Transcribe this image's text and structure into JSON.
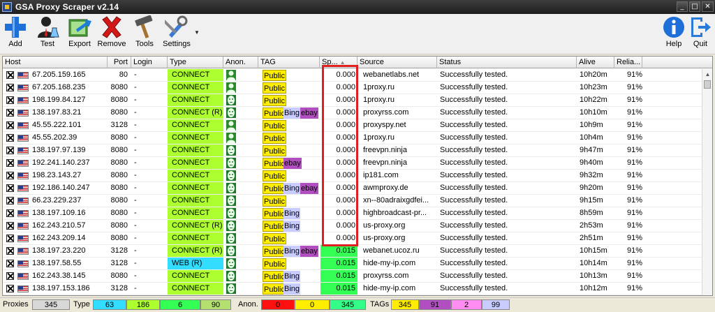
{
  "window": {
    "title": "GSA Proxy Scraper v2.14"
  },
  "toolbar": {
    "add": "Add",
    "test": "Test",
    "export": "Export",
    "remove": "Remove",
    "tools": "Tools",
    "settings": "Settings",
    "help": "Help",
    "quit": "Quit"
  },
  "columns": {
    "host": "Host",
    "port": "Port",
    "login": "Login",
    "type": "Type",
    "anon": "Anon.",
    "tag": "TAG",
    "speed": "Sp...",
    "source": "Source",
    "status": "Status",
    "alive": "Alive",
    "reliability": "Relia..."
  },
  "rows": [
    {
      "host": "67.205.159.165",
      "port": "80",
      "login": "-",
      "type": "CONNECT",
      "type_kind": "connect",
      "anon": "elite",
      "tags": [
        "Public"
      ],
      "speed": "0.000",
      "source": "webanetlabs.net",
      "status": "Successfully tested.",
      "alive": "10h20m",
      "reliability": "91%"
    },
    {
      "host": "67.205.168.235",
      "port": "8080",
      "login": "-",
      "type": "CONNECT",
      "type_kind": "connect",
      "anon": "elite",
      "tags": [
        "Public"
      ],
      "speed": "0.000",
      "source": "1proxy.ru",
      "status": "Successfully tested.",
      "alive": "10h23m",
      "reliability": "91%"
    },
    {
      "host": "198.199.84.127",
      "port": "8080",
      "login": "-",
      "type": "CONNECT",
      "type_kind": "connect",
      "anon": "anonymous",
      "tags": [
        "Public"
      ],
      "speed": "0.000",
      "source": "1proxy.ru",
      "status": "Successfully tested.",
      "alive": "10h22m",
      "reliability": "91%"
    },
    {
      "host": "138.197.83.21",
      "port": "8080",
      "login": "-",
      "type": "CONNECT (R)",
      "type_kind": "connect",
      "anon": "anonymous",
      "tags": [
        "Public",
        "Bing",
        "ebay"
      ],
      "speed": "0.000",
      "source": "proxyrss.com",
      "status": "Successfully tested.",
      "alive": "10h10m",
      "reliability": "91%"
    },
    {
      "host": "45.55.222.101",
      "port": "3128",
      "login": "-",
      "type": "CONNECT",
      "type_kind": "connect",
      "anon": "elite",
      "tags": [
        "Public"
      ],
      "speed": "0.000",
      "source": "proxyspy.net",
      "status": "Successfully tested.",
      "alive": "10h9m",
      "reliability": "91%"
    },
    {
      "host": "45.55.202.39",
      "port": "8080",
      "login": "-",
      "type": "CONNECT",
      "type_kind": "connect",
      "anon": "elite",
      "tags": [
        "Public"
      ],
      "speed": "0.000",
      "source": "1proxy.ru",
      "status": "Successfully tested.",
      "alive": "10h4m",
      "reliability": "91%"
    },
    {
      "host": "138.197.97.139",
      "port": "8080",
      "login": "-",
      "type": "CONNECT",
      "type_kind": "connect",
      "anon": "anonymous",
      "tags": [
        "Public"
      ],
      "speed": "0.000",
      "source": "freevpn.ninja",
      "status": "Successfully tested.",
      "alive": "9h47m",
      "reliability": "91%"
    },
    {
      "host": "192.241.140.237",
      "port": "8080",
      "login": "-",
      "type": "CONNECT",
      "type_kind": "connect",
      "anon": "anonymous",
      "tags": [
        "Public",
        "ebay"
      ],
      "speed": "0.000",
      "source": "freevpn.ninja",
      "status": "Successfully tested.",
      "alive": "9h40m",
      "reliability": "91%"
    },
    {
      "host": "198.23.143.27",
      "port": "8080",
      "login": "-",
      "type": "CONNECT",
      "type_kind": "connect",
      "anon": "anonymous",
      "tags": [
        "Public"
      ],
      "speed": "0.000",
      "source": "ip181.com",
      "status": "Successfully tested.",
      "alive": "9h32m",
      "reliability": "91%"
    },
    {
      "host": "192.186.140.247",
      "port": "8080",
      "login": "-",
      "type": "CONNECT",
      "type_kind": "connect",
      "anon": "anonymous",
      "tags": [
        "Public",
        "Bing",
        "ebay"
      ],
      "speed": "0.000",
      "source": "awmproxy.de",
      "status": "Successfully tested.",
      "alive": "9h20m",
      "reliability": "91%"
    },
    {
      "host": "66.23.229.237",
      "port": "8080",
      "login": "-",
      "type": "CONNECT",
      "type_kind": "connect",
      "anon": "anonymous",
      "tags": [
        "Public"
      ],
      "speed": "0.000",
      "source": "xn--80adraixgdfei...",
      "status": "Successfully tested.",
      "alive": "9h15m",
      "reliability": "91%"
    },
    {
      "host": "138.197.109.16",
      "port": "8080",
      "login": "-",
      "type": "CONNECT",
      "type_kind": "connect",
      "anon": "anonymous",
      "tags": [
        "Public",
        "Bing"
      ],
      "speed": "0.000",
      "source": "highbroadcast-pr...",
      "status": "Successfully tested.",
      "alive": "8h59m",
      "reliability": "91%"
    },
    {
      "host": "162.243.210.57",
      "port": "8080",
      "login": "-",
      "type": "CONNECT (R)",
      "type_kind": "connect",
      "anon": "anonymous",
      "tags": [
        "Public",
        "Bing"
      ],
      "speed": "0.000",
      "source": "us-proxy.org",
      "status": "Successfully tested.",
      "alive": "2h53m",
      "reliability": "91%"
    },
    {
      "host": "162.243.209.14",
      "port": "8080",
      "login": "-",
      "type": "CONNECT",
      "type_kind": "connect",
      "anon": "anonymous",
      "tags": [
        "Public"
      ],
      "speed": "0.000",
      "source": "us-proxy.org",
      "status": "Successfully tested.",
      "alive": "2h51m",
      "reliability": "91%"
    },
    {
      "host": "138.197.23.220",
      "port": "3128",
      "login": "-",
      "type": "CONNECT (R)",
      "type_kind": "connect",
      "anon": "anonymous",
      "tags": [
        "Public",
        "Bing",
        "ebay"
      ],
      "speed": "0.015",
      "source": "webanet.ucoz.ru",
      "status": "Successfully tested.",
      "alive": "10h15m",
      "reliability": "91%"
    },
    {
      "host": "138.197.58.55",
      "port": "3128",
      "login": "-",
      "type": "WEB (R)",
      "type_kind": "web",
      "anon": "anonymous",
      "tags": [
        "Public"
      ],
      "speed": "0.015",
      "source": "hide-my-ip.com",
      "status": "Successfully tested.",
      "alive": "10h14m",
      "reliability": "91%"
    },
    {
      "host": "162.243.38.145",
      "port": "8080",
      "login": "-",
      "type": "CONNECT",
      "type_kind": "connect",
      "anon": "anonymous",
      "tags": [
        "Public",
        "Bing"
      ],
      "speed": "0.015",
      "source": "proxyrss.com",
      "status": "Successfully tested.",
      "alive": "10h13m",
      "reliability": "91%"
    },
    {
      "host": "138.197.153.186",
      "port": "3128",
      "login": "-",
      "type": "CONNECT",
      "type_kind": "connect",
      "anon": "anonymous",
      "tags": [
        "Public",
        "Bing"
      ],
      "speed": "0.015",
      "source": "hide-my-ip.com",
      "status": "Successfully tested.",
      "alive": "10h12m",
      "reliability": "91%"
    }
  ],
  "statusbar": {
    "proxies_label": "Proxies",
    "proxies_count": "345",
    "type_label": "Type",
    "type_counts": [
      "63",
      "186",
      "6",
      "90"
    ],
    "anon_label": "Anon.",
    "anon_counts": [
      "0",
      "0",
      "345"
    ],
    "tags_label": "TAGs",
    "tags_counts": [
      "345",
      "91",
      "2",
      "99"
    ]
  },
  "colors": {
    "connect": "#adff2f",
    "web": "#33ddff",
    "fast_speed": "#33ff55",
    "tag_public": "#ffee00",
    "tag_bing": "#c8ccff",
    "tag_ebay": "#b24fc0",
    "highlight": "#e02020"
  }
}
